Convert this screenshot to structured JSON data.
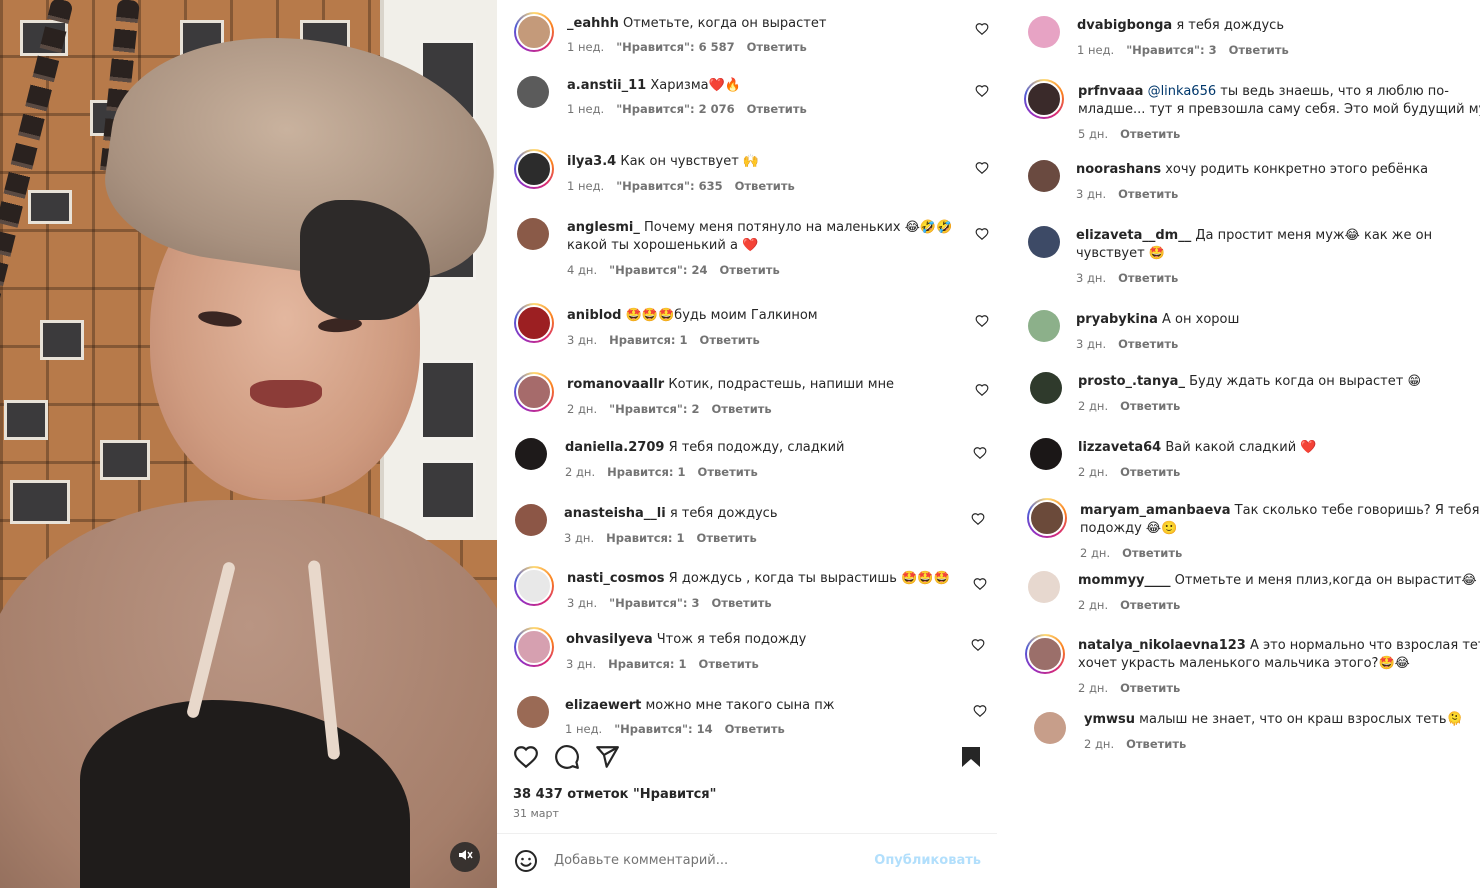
{
  "video": {
    "mute_icon": "speaker-muted-icon"
  },
  "left_comments": [
    {
      "user": "_eahhh",
      "text": "Отметьте, когда он вырастет",
      "time": "1 нед.",
      "likes": "\"Нравится\": 6 587",
      "reply": "Ответить"
    },
    {
      "user": "a.anstii_11",
      "text": "Харизма❤️🔥",
      "time": "1 нед.",
      "likes": "\"Нравится\": 2 076",
      "reply": "Ответить"
    },
    {
      "user": "ilya3.4",
      "text": "Как он чувствует 🙌",
      "time": "1 нед.",
      "likes": "\"Нравится\": 635",
      "reply": "Ответить"
    },
    {
      "user": "anglesmi_",
      "text": "Почему меня потянуло на маленьких 😂🤣🤣",
      "text2": "какой ты хорошенький а ❤️",
      "time": "4 дн.",
      "likes": "\"Нравится\": 24",
      "reply": "Ответить"
    },
    {
      "user": "aniblod",
      "text": "🤩🤩🤩будь моим Галкином",
      "time": "3 дн.",
      "likes": "Нравится: 1",
      "reply": "Ответить"
    },
    {
      "user": "romanovaallr",
      "text": "Котик, подрастешь, напиши мне",
      "time": "2 дн.",
      "likes": "\"Нравится\": 2",
      "reply": "Ответить"
    },
    {
      "user": "daniella.2709",
      "text": "Я тебя подожду, сладкий",
      "time": "2 дн.",
      "likes": "Нравится: 1",
      "reply": "Ответить"
    },
    {
      "user": "anasteisha__li",
      "text": "я тебя дождусь",
      "time": "3 дн.",
      "likes": "Нравится: 1",
      "reply": "Ответить"
    },
    {
      "user": "nasti_cosmos",
      "text": "Я дождусь , когда ты вырастишь 🤩🤩🤩",
      "time": "3 дн.",
      "likes": "\"Нравится\": 3",
      "reply": "Ответить"
    },
    {
      "user": "ohvasilyeva",
      "text": "Чтож я тебя подожду",
      "time": "3 дн.",
      "likes": "Нравится: 1",
      "reply": "Ответить"
    },
    {
      "user": "elizaewert",
      "text": "можно мне такого сына пж",
      "time": "1 нед.",
      "likes": "\"Нравится\": 14",
      "reply": "Ответить"
    }
  ],
  "right_comments": [
    {
      "user": "dvabigbonga",
      "text": "я тебя дождусь",
      "time": "1 нед.",
      "likes": "\"Нравится\": 3",
      "reply": "Ответить"
    },
    {
      "user": "prfnvaaa",
      "mention": "@linka656",
      "text": "ты ведь знаешь, что я люблю по-",
      "text2": "младше... тут я превзошла саму себя. Это мой будущий муж!",
      "time": "5 дн.",
      "reply": "Ответить"
    },
    {
      "user": "noorashans",
      "text": "хочу родить конкретно этого ребёнка",
      "time": "3 дн.",
      "reply": "Ответить"
    },
    {
      "user": "elizaveta__dm__",
      "text": "Да простит меня муж😂 как же он",
      "text2": "чувствует 🤩",
      "time": "3 дн.",
      "reply": "Ответить"
    },
    {
      "user": "pryabykina",
      "text": "А он хорош",
      "time": "3 дн.",
      "reply": "Ответить"
    },
    {
      "user": "prosto_.tanya_",
      "text": "Буду ждать когда он вырастет 😁",
      "time": "2 дн.",
      "reply": "Ответить"
    },
    {
      "user": "lizzaveta64",
      "text": "Вай какой сладкий ❤️",
      "time": "2 дн.",
      "reply": "Ответить"
    },
    {
      "user": "maryam_amanbaeva",
      "text": "Так сколько тебе говоришь? Я тебя",
      "text2": "подожду 😂🙂",
      "time": "2 дн.",
      "reply": "Ответить"
    },
    {
      "user": "mommyy____",
      "text": "Отметьте и меня плиз,когда он вырастит😂",
      "time": "2 дн.",
      "reply": "Ответить"
    },
    {
      "user": "natalya_nikolaevna123",
      "text": "А это нормально что взрослая тетя",
      "text2": "хочет украсть маленького мальчика этого?🤩😂",
      "time": "2 дн.",
      "reply": "Ответить"
    },
    {
      "user": "ymwsu",
      "text": "малыш не знает, что он краш взрослых теть🫠",
      "time": "2 дн.",
      "reply": "Ответить"
    }
  ],
  "actions": {
    "like_icon": "heart-icon",
    "comment_icon": "comment-icon",
    "share_icon": "share-icon",
    "save_icon": "bookmark-icon"
  },
  "post": {
    "likes_total": "38 437 отметок \"Нравится\"",
    "date": "31 март"
  },
  "add_comment": {
    "placeholder": "Добавьте комментарий...",
    "publish": "Опубликовать",
    "emoji_icon": "smiley-icon"
  }
}
